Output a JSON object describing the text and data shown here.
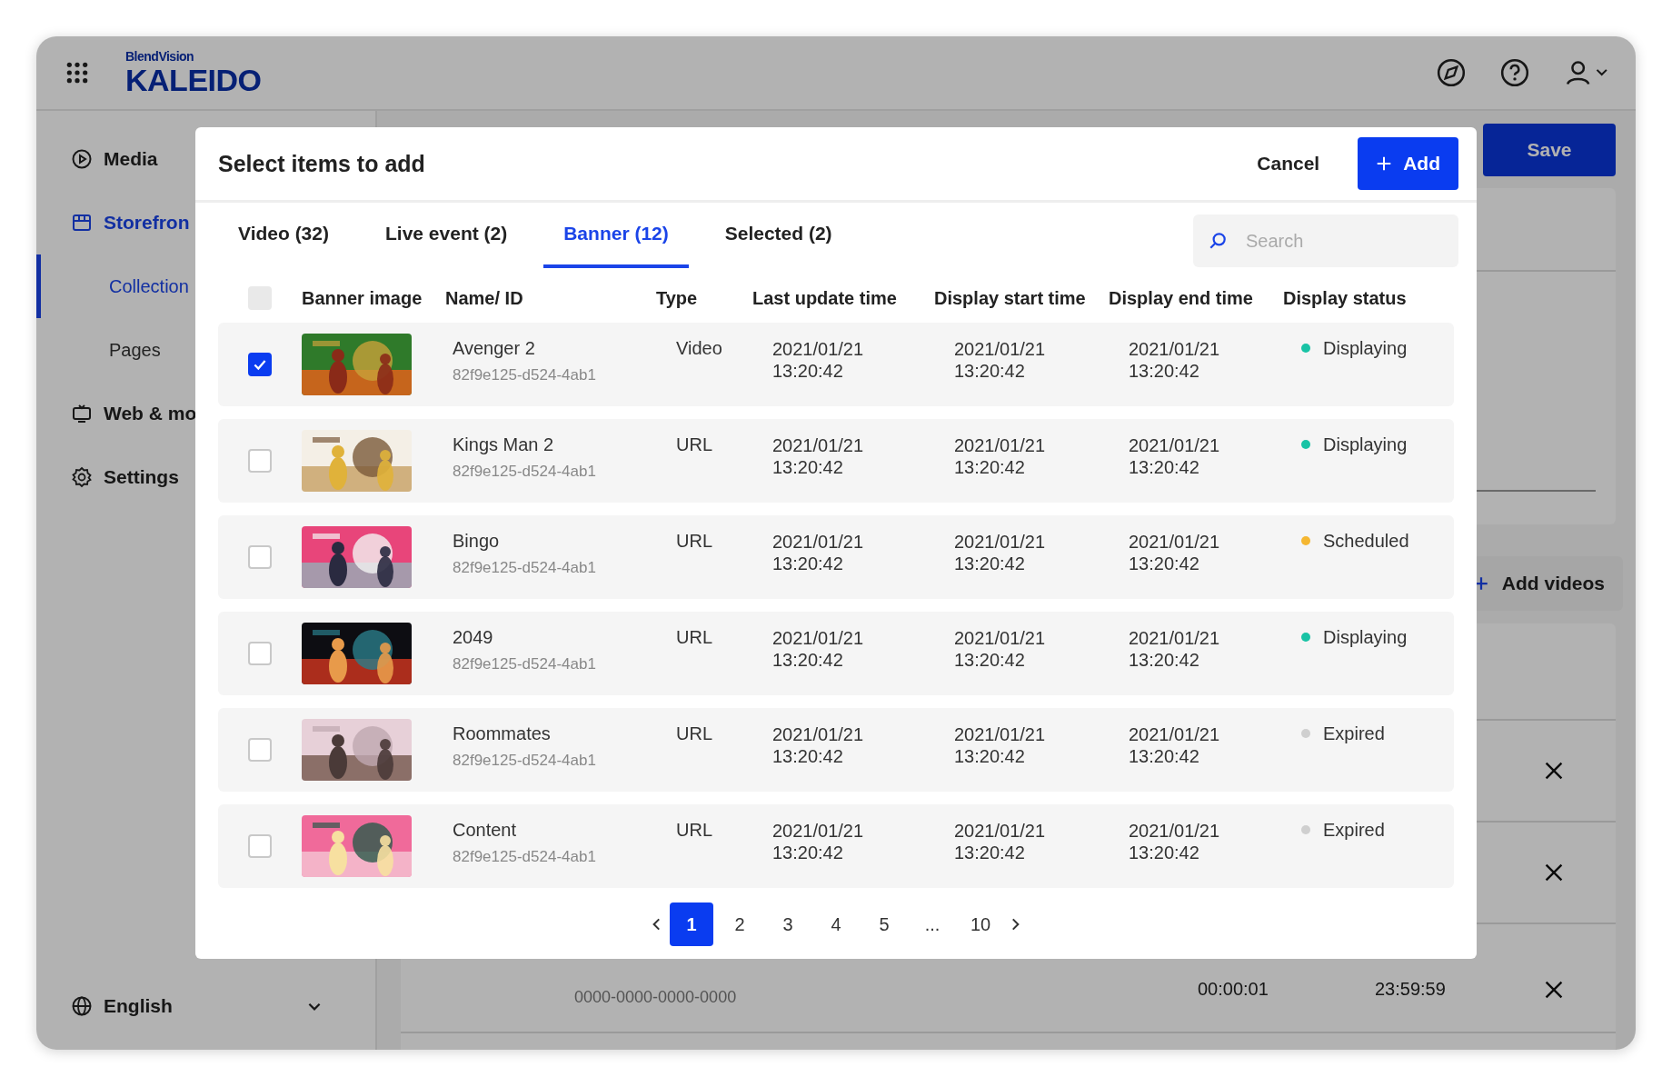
{
  "app": {
    "brand": "BlendVision",
    "product": "KALEIDO"
  },
  "sidebar": {
    "items": [
      {
        "label": "Media",
        "kind": "media",
        "active": false
      },
      {
        "label": "Storefron",
        "kind": "store",
        "active": true,
        "children": [
          {
            "label": "Collection",
            "selected": true
          },
          {
            "label": "Pages",
            "selected": false
          }
        ]
      },
      {
        "label": "Web & mo",
        "kind": "tv",
        "active": false
      },
      {
        "label": "Settings",
        "kind": "gear",
        "active": false
      }
    ],
    "language": "English"
  },
  "page": {
    "save": "Save",
    "add_videos": "Add videos",
    "rows": [
      {
        "id": "0000-0000-0000-0000",
        "start": "00:00:01",
        "end": "23:59:59"
      }
    ]
  },
  "modal": {
    "title": "Select items to add",
    "cancel": "Cancel",
    "add": "Add",
    "tabs": [
      {
        "label": "Video (32)",
        "selected": false
      },
      {
        "label": "Live event (2)",
        "selected": false
      },
      {
        "label": "Banner (12)",
        "selected": true
      },
      {
        "label": "Selected (2)",
        "selected": false
      }
    ],
    "search": {
      "placeholder": "Search"
    },
    "header_checkbox": {
      "disabled": true
    },
    "columns": [
      "Banner image",
      "Name/ ID",
      "Type",
      "Last update time",
      "Display start time",
      "Display end time",
      "Display status"
    ],
    "rows": [
      {
        "checked": true,
        "name": "Avenger 2",
        "id": "82f9e125-d524-4ab1",
        "type": "Video",
        "updated": "2021/01/21\n13:20:42",
        "start": "2021/01/21\n13:20:42",
        "end": "2021/01/21\n13:20:42",
        "status": "Displaying",
        "color": "#19c3a5"
      },
      {
        "checked": false,
        "name": "Kings Man 2",
        "id": "82f9e125-d524-4ab1",
        "type": "URL",
        "updated": "2021/01/21\n13:20:42",
        "start": "2021/01/21\n13:20:42",
        "end": "2021/01/21\n13:20:42",
        "status": "Displaying",
        "color": "#19c3a5"
      },
      {
        "checked": false,
        "name": "Bingo",
        "id": "82f9e125-d524-4ab1",
        "type": "URL",
        "updated": "2021/01/21\n13:20:42",
        "start": "2021/01/21\n13:20:42",
        "end": "2021/01/21\n13:20:42",
        "status": "Scheduled",
        "color": "#f5b731"
      },
      {
        "checked": false,
        "name": "2049",
        "id": "82f9e125-d524-4ab1",
        "type": "URL",
        "updated": "2021/01/21\n13:20:42",
        "start": "2021/01/21\n13:20:42",
        "end": "2021/01/21\n13:20:42",
        "status": "Displaying",
        "color": "#19c3a5"
      },
      {
        "checked": false,
        "name": "Roommates",
        "id": "82f9e125-d524-4ab1",
        "type": "URL",
        "updated": "2021/01/21\n13:20:42",
        "start": "2021/01/21\n13:20:42",
        "end": "2021/01/21\n13:20:42",
        "status": "Expired",
        "color": "#cfcfcf"
      },
      {
        "checked": false,
        "name": "Content",
        "id": "82f9e125-d524-4ab1",
        "type": "URL",
        "updated": "2021/01/21\n13:20:42",
        "start": "2021/01/21\n13:20:42",
        "end": "2021/01/21\n13:20:42",
        "status": "Expired",
        "color": "#cfcfcf"
      }
    ],
    "pages": [
      {
        "label": "1",
        "selected": true
      },
      {
        "label": "2",
        "selected": false
      },
      {
        "label": "3",
        "selected": false
      },
      {
        "label": "4",
        "selected": false
      },
      {
        "label": "5",
        "selected": false
      },
      {
        "label": "...",
        "selected": false
      },
      {
        "label": "10",
        "selected": false
      }
    ]
  }
}
